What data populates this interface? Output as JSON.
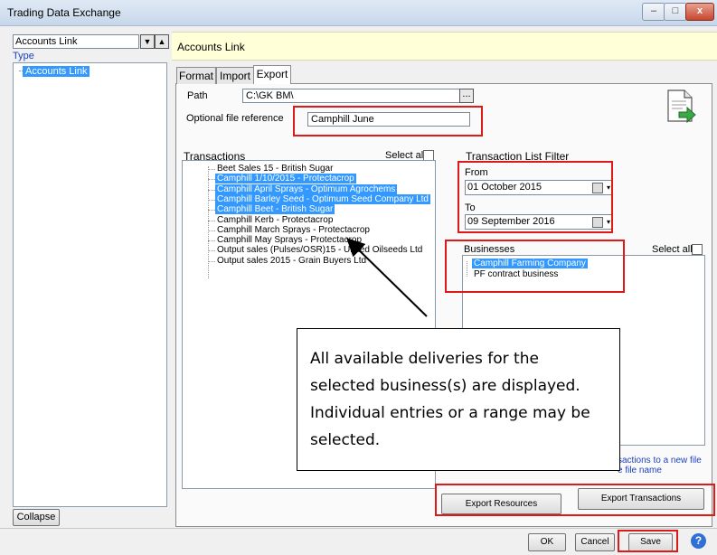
{
  "window": {
    "title": "Trading Data Exchange",
    "min": "–",
    "max": "□",
    "close": "x"
  },
  "left": {
    "type_select": "Accounts Link",
    "type_label": "Type",
    "tree_item": "Accounts Link",
    "collapse": "Collapse"
  },
  "header": {
    "title": "Accounts Link"
  },
  "tabs": [
    {
      "label": "Format"
    },
    {
      "label": "Import"
    },
    {
      "label": "Export"
    }
  ],
  "export": {
    "path_label": "Path",
    "path_value": "C:\\GK BM\\",
    "browse": "...",
    "ref_label": "Optional file reference",
    "ref_value": "Camphill June"
  },
  "transactions": {
    "label": "Transactions",
    "select_all": "Select all",
    "items": [
      "Beet Sales 15 - British Sugar",
      "Camphill 1/10/2015 - Protectacrop",
      "Camphill April Sprays - Optimum Agrochems",
      "Camphill Barley Seed - Optimum Seed Company Ltd",
      "Camphill Beet - British Sugar",
      "Camphill Kerb - Protectacrop",
      "Camphill March Sprays - Protectacrop",
      "Camphill May Sprays - Protectacrop",
      "Output sales (Pulses/OSR)15 - United Oilseeds Ltd",
      "Output sales 2015 - Grain Buyers Ltd"
    ],
    "selected": [
      1,
      2,
      3,
      4
    ]
  },
  "filter": {
    "label": "Transaction List Filter",
    "from_label": "From",
    "from_value": "01  October   2015",
    "to_label": "To",
    "to_value": "09 September 2016"
  },
  "businesses": {
    "label": "Businesses",
    "select_all": "Select all",
    "items": [
      "Camphill Farming Company",
      "PF contract business"
    ]
  },
  "side_note": {
    "line1": "sactions to a new file",
    "line2": "e file name"
  },
  "callout": {
    "text": "All available deliveries for the selected business(s) are displayed.  Individual entries or a range may be selected."
  },
  "buttons": {
    "export_resources": "Export Resources",
    "export_transactions": "Export Transactions",
    "ok": "OK",
    "cancel": "Cancel",
    "save": "Save",
    "help": "?"
  },
  "colors": {
    "highlight": "#e01818",
    "selection": "#3399ff",
    "header_band": "#ffffd8"
  }
}
